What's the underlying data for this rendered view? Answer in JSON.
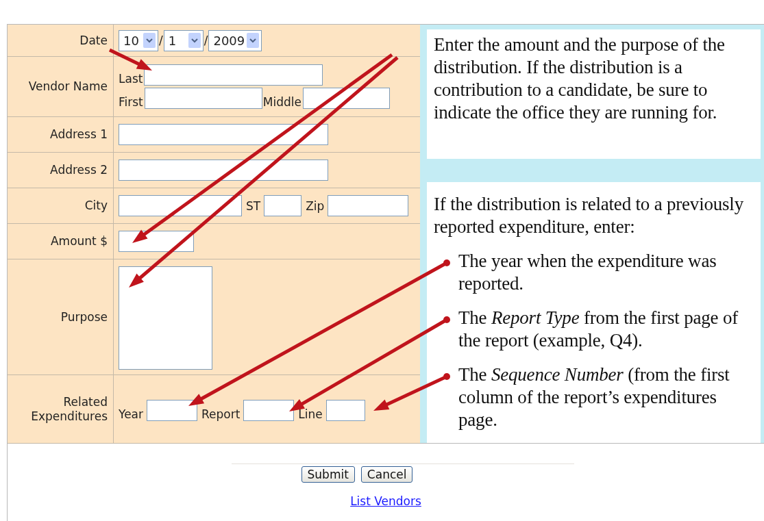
{
  "form": {
    "rows": [
      {
        "kind": "date",
        "label": "Date",
        "selects": [
          "10",
          "1",
          "2009"
        ],
        "separators": [
          "/",
          "/"
        ]
      },
      {
        "kind": "name",
        "label": "Vendor Name",
        "sub_labels": [
          "Last",
          "First",
          "Middle"
        ]
      },
      {
        "kind": "text",
        "label": "Address 1"
      },
      {
        "kind": "text",
        "label": "Address 2"
      },
      {
        "kind": "city",
        "label": "City",
        "sub_labels": [
          "ST",
          "Zip"
        ]
      },
      {
        "kind": "amount",
        "label": "Amount $"
      },
      {
        "kind": "textarea",
        "label": "Purpose"
      },
      {
        "kind": "related",
        "label": "Related Expenditures",
        "sub_labels": [
          "Year",
          "Report",
          "Line"
        ]
      }
    ]
  },
  "notes": [
    {
      "text": "Enter the amount and the purpose of the distribution. If the distribution is a contribution to a candidate, be sure to indicate the office they are running for."
    },
    {
      "text": "If the distribution is related to a previously reported expenditure, enter:",
      "items": [
        "The year when the expenditure was reported.",
        "The *Report Type* from the first page of the report (example, Q4).",
        "The *Sequence Number* (from the first column of the report’s expenditures page."
      ]
    }
  ],
  "buttons": [
    "Submit",
    "Cancel"
  ],
  "link": "List Vendors"
}
